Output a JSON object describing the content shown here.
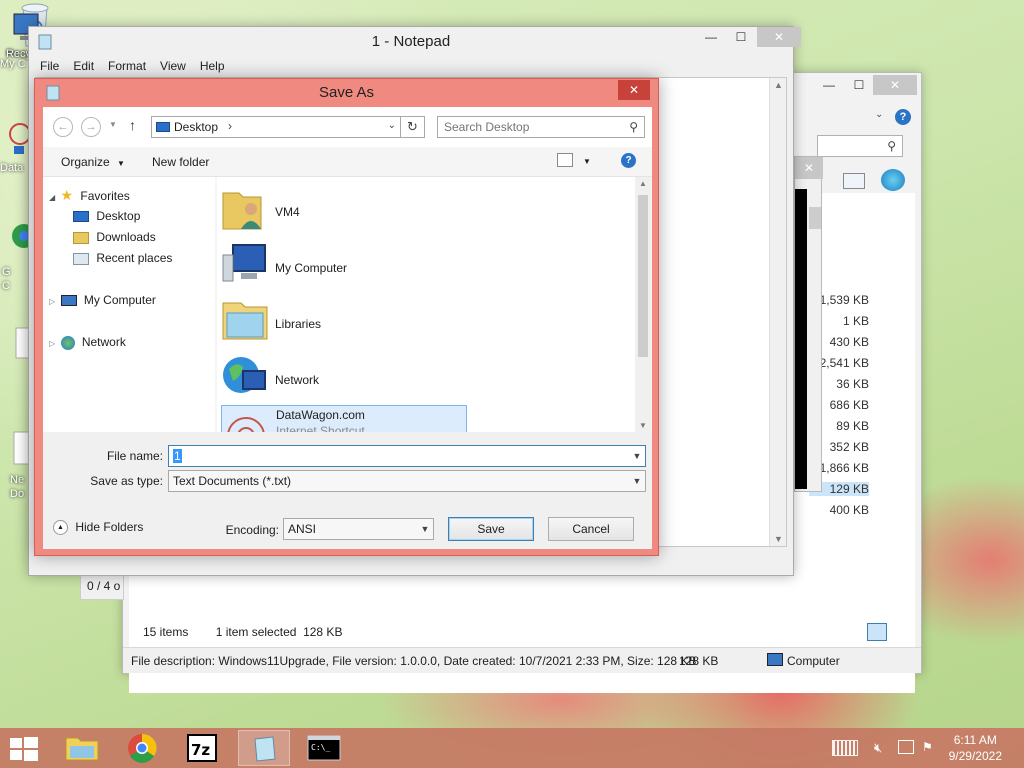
{
  "desktop": {
    "icons": [
      "My C",
      "Data",
      "G",
      "C",
      "Ne",
      "Do"
    ],
    "recycle_bin": "Recycle Bin"
  },
  "explorer_back": {
    "sizes": [
      "1,539 KB",
      "1 KB",
      "430 KB",
      "2,541 KB",
      "36 KB",
      "686 KB",
      "89 KB",
      "352 KB",
      "1,866 KB",
      "129 KB",
      "400 KB"
    ],
    "items_count": "15 items",
    "selected_info": "1 item selected  128 KB",
    "file_description": "File description: Windows11Upgrade, File version: 1.0.0.0, Date created: 10/7/2021 2:33 PM, Size: 128 KB",
    "size_short": "128 KB",
    "location": "Computer",
    "partial_status": "0 / 4 o"
  },
  "notepad": {
    "title": "1 - Notepad",
    "menu": [
      "File",
      "Edit",
      "Format",
      "View",
      "Help"
    ],
    "minimize": "—",
    "maximize": "☐",
    "close": "✕"
  },
  "dialog": {
    "title": "Save As",
    "close": "✕",
    "address": "Desktop",
    "search_placeholder": "Search Desktop",
    "organize": "Organize",
    "new_folder": "New folder",
    "tree": {
      "favorites": "Favorites",
      "desktop": "Desktop",
      "downloads": "Downloads",
      "recent": "Recent places",
      "my_computer": "My Computer",
      "network": "Network"
    },
    "files": [
      {
        "name": "VM4"
      },
      {
        "name": "My Computer"
      },
      {
        "name": "Libraries"
      },
      {
        "name": "Network"
      },
      {
        "name": "DataWagon.com",
        "sub": "Internet Shortcut"
      }
    ],
    "file_name_label": "File name:",
    "file_name_value": "1",
    "save_type_label": "Save as type:",
    "save_type_value": "Text Documents (*.txt)",
    "hide_folders": "Hide Folders",
    "encoding_label": "Encoding:",
    "encoding_value": "ANSI",
    "save": "Save",
    "cancel": "Cancel"
  },
  "taskbar": {
    "time": "6:11 AM",
    "date": "9/29/2022",
    "apps": [
      "file-explorer",
      "chrome",
      "7zip",
      "notepad",
      "cmd"
    ]
  }
}
